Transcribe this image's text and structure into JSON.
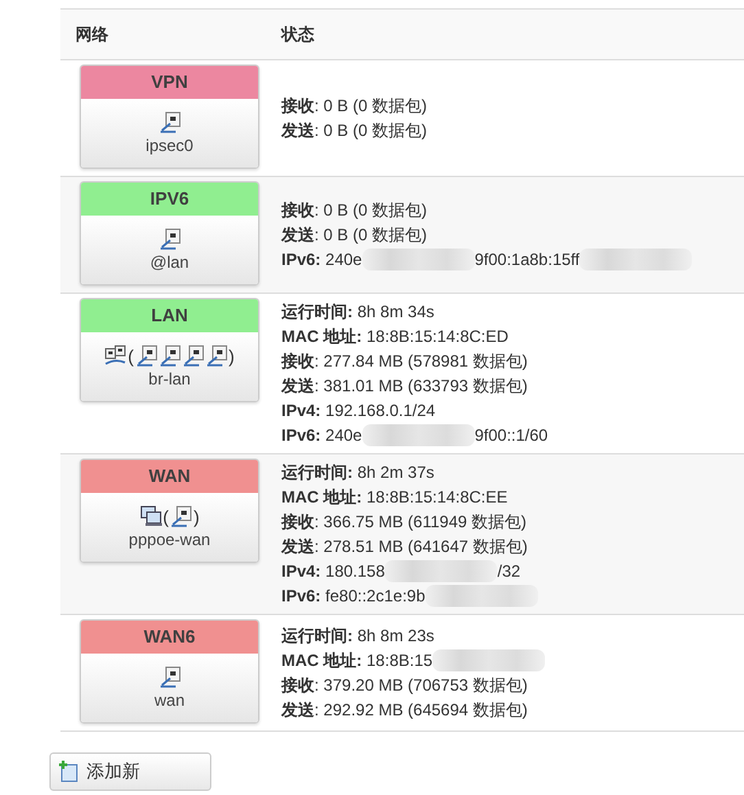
{
  "table": {
    "columns": [
      "网络",
      "状态"
    ],
    "rows": [
      {
        "name": "VPN",
        "color": "#ec87a0",
        "device": "ipsec0",
        "icons": {
          "main": {
            "kind": "port"
          }
        },
        "lines": [
          {
            "segments": [
              {
                "kind": "text",
                "text": "**接收**: 0 B (0 数据包)"
              }
            ]
          },
          {
            "segments": [
              {
                "kind": "text",
                "text": "**发送**: 0 B (0 数据包)"
              }
            ]
          }
        ]
      },
      {
        "name": "IPV6",
        "color": "#90ee90",
        "device": "@lan",
        "icons": {
          "main": {
            "kind": "port"
          }
        },
        "lines": [
          {
            "segments": [
              {
                "kind": "text",
                "text": "**接收**: 0 B (0 数据包)"
              }
            ]
          },
          {
            "segments": [
              {
                "kind": "text",
                "text": "**发送**: 0 B (0 数据包)"
              }
            ]
          },
          {
            "segments": [
              {
                "kind": "text",
                "text": "**IPv6:** 240e"
              },
              {
                "kind": "redaction"
              },
              {
                "kind": "text",
                "text": "9f00:1a8b:15ff"
              },
              {
                "kind": "redaction"
              }
            ]
          }
        ]
      },
      {
        "name": "LAN",
        "color": "#90ee90",
        "device": "br-lan",
        "icons": {
          "main": {
            "kind": "bridge"
          },
          "open": "(",
          "members": [
            {
              "kind": "port"
            },
            {
              "kind": "port"
            },
            {
              "kind": "port"
            },
            {
              "kind": "port"
            }
          ],
          "close": ")"
        },
        "lines": [
          {
            "segments": [
              {
                "kind": "text",
                "text": "**运行时间:** 8h 8m 34s"
              }
            ]
          },
          {
            "segments": [
              {
                "kind": "text",
                "text": "**MAC 地址:** 18:8B:15:14:8C:ED"
              }
            ]
          },
          {
            "segments": [
              {
                "kind": "text",
                "text": "**接收**: 277.84 MB (578981 数据包)"
              }
            ]
          },
          {
            "segments": [
              {
                "kind": "text",
                "text": "**发送**: 381.01 MB (633793 数据包)"
              }
            ]
          },
          {
            "segments": [
              {
                "kind": "text",
                "text": "**IPv4:** 192.168.0.1/24"
              }
            ]
          },
          {
            "segments": [
              {
                "kind": "text",
                "text": "**IPv6:** 240e"
              },
              {
                "kind": "redaction"
              },
              {
                "kind": "text",
                "text": "9f00::1/60"
              }
            ]
          }
        ]
      },
      {
        "name": "WAN",
        "color": "#f09090",
        "device": "pppoe-wan",
        "icons": {
          "main": {
            "kind": "computer"
          },
          "open": "(",
          "members": [
            {
              "kind": "port"
            }
          ],
          "close": ")"
        },
        "lines": [
          {
            "segments": [
              {
                "kind": "text",
                "text": "**运行时间:** 8h 2m 37s"
              }
            ]
          },
          {
            "segments": [
              {
                "kind": "text",
                "text": "**MAC 地址:** 18:8B:15:14:8C:EE"
              }
            ]
          },
          {
            "segments": [
              {
                "kind": "text",
                "text": "**接收**: 366.75 MB (611949 数据包)"
              }
            ]
          },
          {
            "segments": [
              {
                "kind": "text",
                "text": "**发送**: 278.51 MB (641647 数据包)"
              }
            ]
          },
          {
            "segments": [
              {
                "kind": "text",
                "text": "**IPv4:** 180.158"
              },
              {
                "kind": "redaction"
              },
              {
                "kind": "text",
                "text": "/32"
              }
            ]
          },
          {
            "segments": [
              {
                "kind": "text",
                "text": "**IPv6:** fe80::2c1e:9b"
              },
              {
                "kind": "redaction"
              }
            ]
          }
        ]
      },
      {
        "name": "WAN6",
        "color": "#f09090",
        "device": "wan",
        "icons": {
          "main": {
            "kind": "port"
          }
        },
        "lines": [
          {
            "segments": [
              {
                "kind": "text",
                "text": "**运行时间:** 8h 8m 23s"
              }
            ]
          },
          {
            "segments": [
              {
                "kind": "text",
                "text": "**MAC 地址:** 18:8B:15"
              },
              {
                "kind": "redaction"
              }
            ]
          },
          {
            "segments": [
              {
                "kind": "text",
                "text": "**接收**: 379.20 MB (706753 数据包)"
              }
            ]
          },
          {
            "segments": [
              {
                "kind": "text",
                "text": "**发送**: 292.92 MB (645694 数据包)"
              }
            ]
          }
        ]
      }
    ]
  },
  "add_button": {
    "label": "添加新"
  }
}
